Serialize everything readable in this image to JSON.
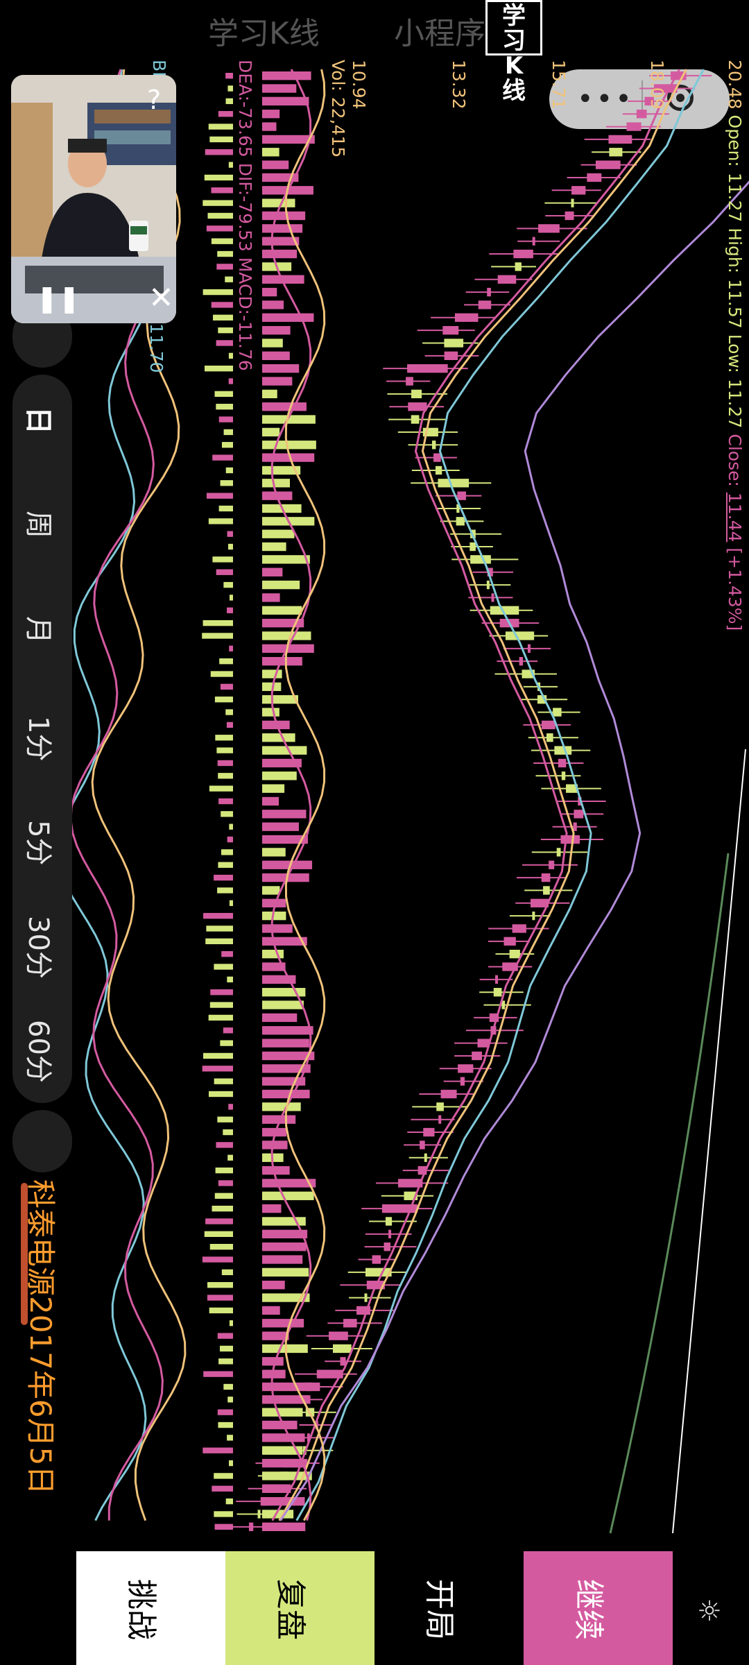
{
  "header": {
    "title": "学习K线",
    "subtitle": "小程序",
    "logo": "学习K线"
  },
  "info": {
    "open_label": "Open:",
    "open": "11.27",
    "high_label": "High:",
    "high": "11.57",
    "low_label": "Low:",
    "low": "11.27",
    "close_label": "Close:",
    "close": "11.44",
    "change": "[+1.43%]"
  },
  "price_levels": [
    "20.48",
    "18.09",
    "15.71",
    "13.32",
    "10.94"
  ],
  "volume": "Vol: 22,415",
  "macd": {
    "dea": "DEA:-73.65",
    "dif": "DIF:-79.53",
    "macd": "MACD:-11.76"
  },
  "left_indicator": {
    "label": "BI",
    "value": "11.70"
  },
  "sidebar": {
    "items": [
      {
        "label": "日"
      },
      {
        "label": "周"
      },
      {
        "label": "月"
      },
      {
        "label": "1分"
      },
      {
        "label": "5分"
      },
      {
        "label": "30分"
      },
      {
        "label": "60分"
      }
    ]
  },
  "stock": {
    "name_date": "科泰电源2017年6月5日",
    "progress": 0.18
  },
  "buttons": {
    "challenge": "挑战",
    "review": "复盘",
    "start": "开局",
    "continue": "继续"
  },
  "colors": {
    "up": "#d4e77d",
    "down": "#d45aa0",
    "accent": "#ff9d2e",
    "ma_pink": "#d45aa0",
    "ma_yellow": "#f0c27a",
    "ma_cyan": "#7fc8d8",
    "ma_purple": "#b08ad8",
    "ma_green": "#5a8a5a"
  },
  "icons": {
    "play": "pause-icon",
    "close": "close-icon",
    "help": "help-icon",
    "settings": "gear-icon",
    "menu": "more-dots-icon",
    "target": "target-icon"
  }
}
